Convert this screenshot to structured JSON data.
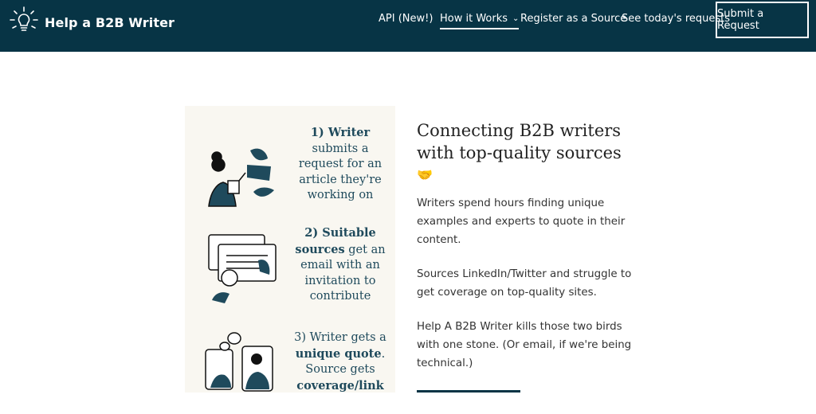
{
  "header": {
    "brand": "Help a B2B Writer",
    "nav": [
      {
        "label": "API (New!)"
      },
      {
        "label": "How it Works"
      },
      {
        "label": "Register as a Source"
      },
      {
        "label": "See today's requests"
      }
    ],
    "cta": "Submit a Request"
  },
  "steps": [
    {
      "num": "1)",
      "bold": "Writer",
      "rest": "submits a request for an article they're working on"
    },
    {
      "num": "2)",
      "bold": "Suitable sources",
      "rest": "get an email with an invitation to contribute"
    },
    {
      "num": "3)",
      "lead": "Writer gets a",
      "bold": "unique quote",
      "mid": ". Source gets",
      "bold2": "coverage/link"
    }
  ],
  "main": {
    "headline": "Connecting B2B writers with top-quality sources",
    "emoji": "🤝",
    "paragraphs": [
      "Writers spend hours finding unique examples and experts to quote in their content.",
      "Sources LinkedIn/Twitter and struggle to get coverage on top-quality sites.",
      "Help A B2B Writer kills those two birds with one stone. (Or email, if we're being technical.)"
    ]
  },
  "colors": {
    "header_bg": "#073445",
    "panel_bg": "#f9f7f1",
    "caption": "#1f4a5c"
  }
}
